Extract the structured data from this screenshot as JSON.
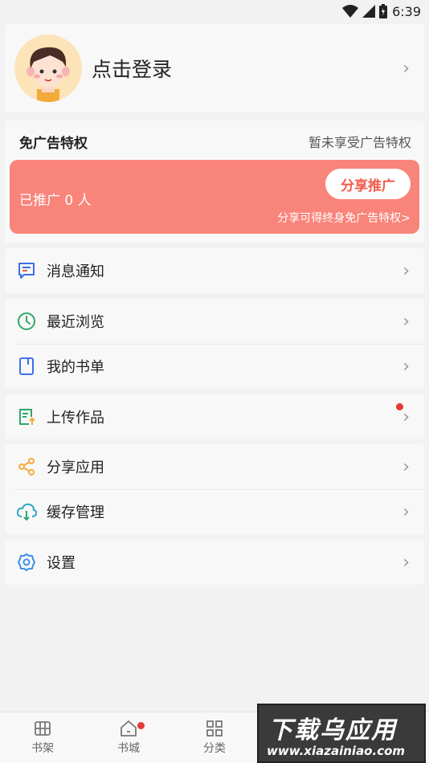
{
  "status_bar": {
    "time": "6:39",
    "battery_icon": "battery-icon",
    "wifi_icon": "wifi-icon",
    "signal_icon": "signal-icon"
  },
  "profile": {
    "login_label": "点击登录",
    "avatar_icon": "avatar-cartoon-boy"
  },
  "ad_privilege": {
    "title": "免广告特权",
    "status": "暂未享受广告特权",
    "promoted_count_text": "已推广 0 人",
    "share_button_label": "分享推广",
    "hint": "分享可得终身免广告特权>"
  },
  "menu": {
    "notifications": {
      "label": "消息通知",
      "icon": "message-icon"
    },
    "recent": {
      "label": "最近浏览",
      "icon": "clock-icon"
    },
    "booklist": {
      "label": "我的书单",
      "icon": "book-icon"
    },
    "upload": {
      "label": "上传作品",
      "icon": "upload-doc-icon",
      "has_badge": true
    },
    "share_app": {
      "label": "分享应用",
      "icon": "share-icon"
    },
    "cache": {
      "label": "缓存管理",
      "icon": "cloud-download-icon"
    },
    "settings": {
      "label": "设置",
      "icon": "gear-icon"
    }
  },
  "tabbar": {
    "bookshelf": {
      "label": "书架",
      "icon": "bookshelf-icon"
    },
    "bookstore": {
      "label": "书城",
      "icon": "home-icon",
      "has_badge": true
    },
    "category": {
      "label": "分类",
      "icon": "grid-icon"
    }
  },
  "watermark": {
    "title": "下载乌应用",
    "url": "www.xiazainiao.com"
  },
  "colors": {
    "accent": "#f9847a",
    "button_text": "#f25c4c",
    "badge": "#e53935",
    "background": "#f2f2f2"
  }
}
